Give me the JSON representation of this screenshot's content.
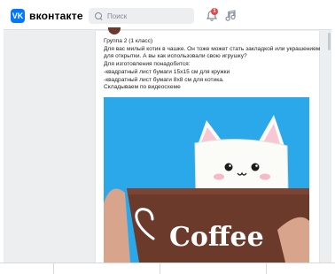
{
  "app": {
    "logo_text": "вконтакте",
    "logo_mark": "VK",
    "brand_color": "#0077ff"
  },
  "header": {
    "search_placeholder": "Поиск",
    "notifications_badge": "1",
    "notification_icon": "bell-icon",
    "music_icon": "music-note-icon"
  },
  "post": {
    "lines": [
      "Группа 2 (1 класс)",
      "Для вас милый котик в чашке. Он тоже может стать закладкой или украшением",
      "для открытки. А вы как использовали свою игрушку?",
      "Для изготовления понадобится:",
      "-квадратный лист бумаги 15х15 см для кружки",
      "-квадратный лист бумаги 8х8 см для котика.",
      "Складываем по видеосхеме"
    ],
    "image": {
      "cup_text": "Coffee",
      "background_color": "#2aa8ea",
      "cup_color": "#6b3a2b"
    }
  }
}
